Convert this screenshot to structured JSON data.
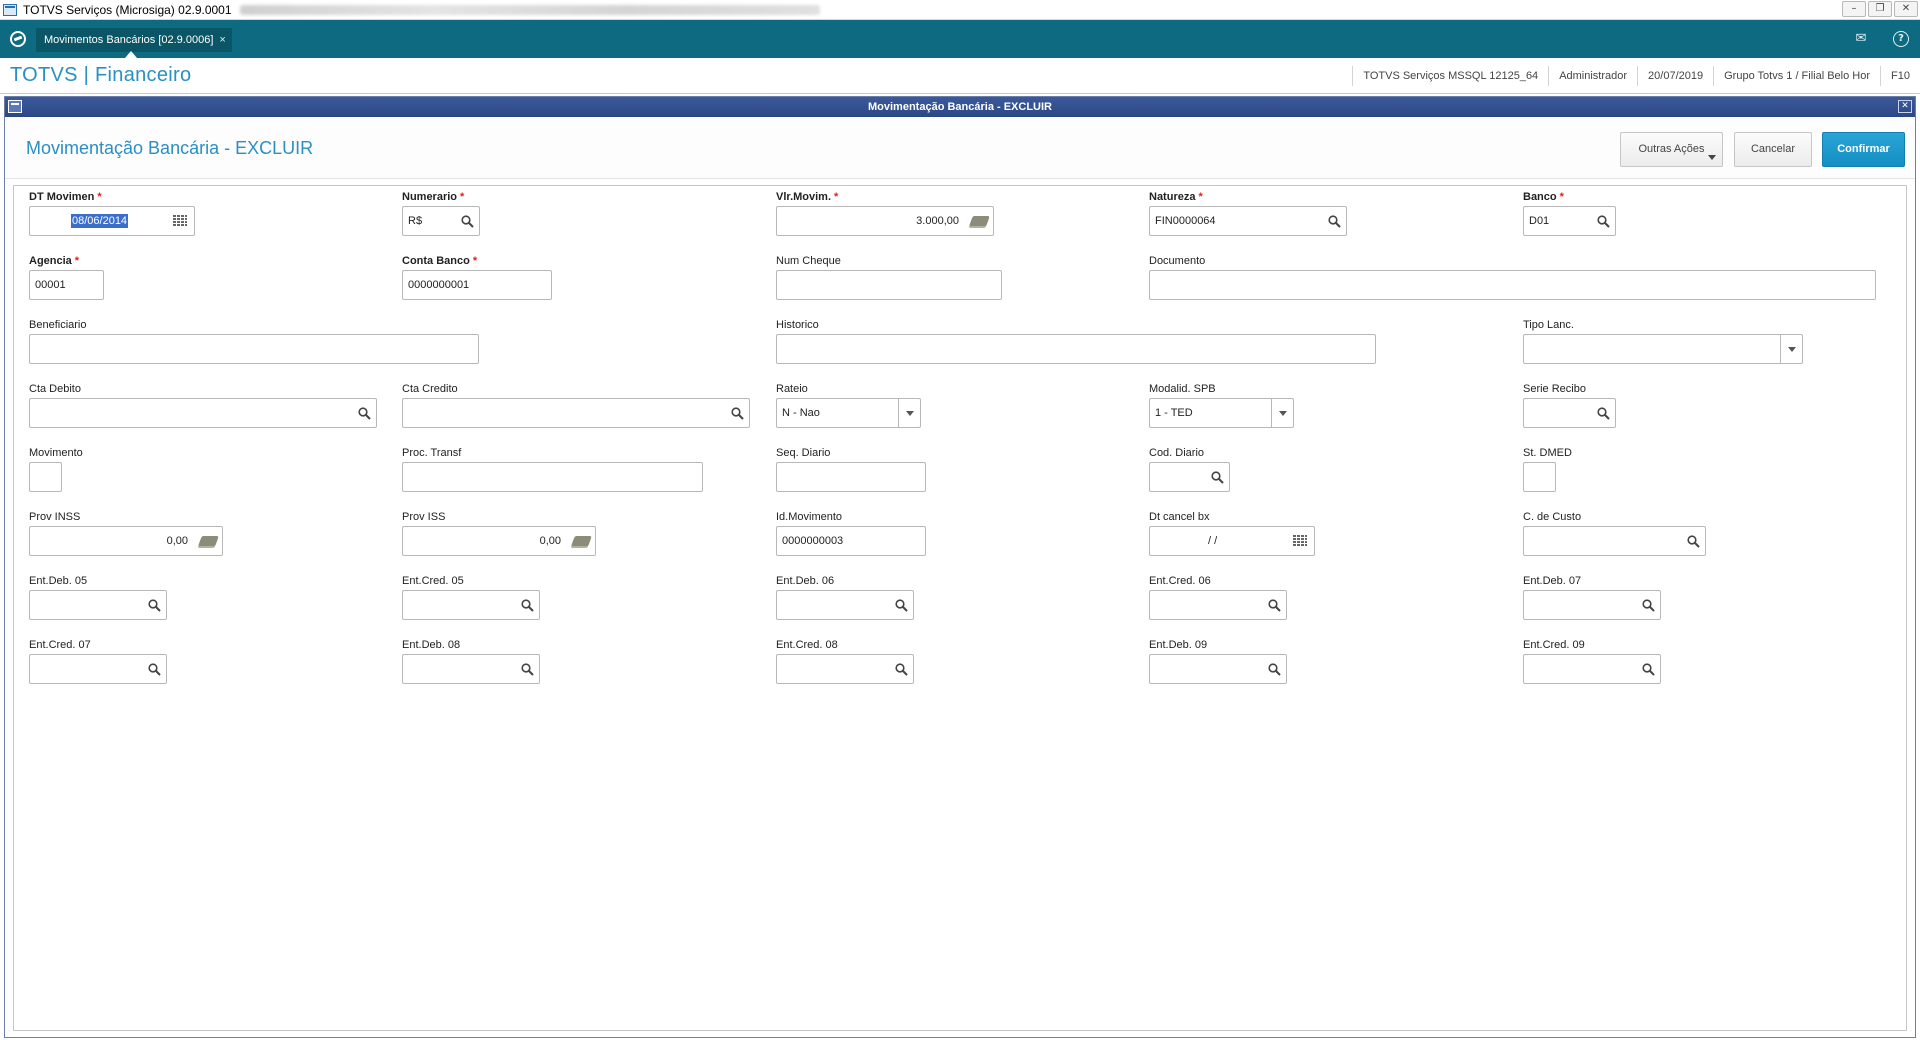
{
  "os": {
    "title": "TOTVS Serviços (Microsiga) 02.9.0001",
    "controls": {
      "minimize": "–",
      "restore": "❐",
      "close": "✕"
    }
  },
  "tabbar": {
    "active_tab": "Movimentos Bancários [02.9.0006]",
    "close_glyph": "×",
    "mail_icon": "✉",
    "help_icon": "?"
  },
  "module": {
    "title": "TOTVS | Financeiro",
    "info": [
      "TOTVS Serviços MSSQL 12125_64",
      "Administrador",
      "20/07/2019",
      "Grupo Totvs 1 / Filial Belo Hor",
      "F10"
    ]
  },
  "dialog": {
    "title": "Movimentação Bancária - EXCLUIR",
    "heading": "Movimentação Bancária - EXCLUIR",
    "close_glyph": "✕",
    "buttons": {
      "outras": "Outras Ações",
      "cancelar": "Cancelar",
      "confirmar": "Confirmar"
    }
  },
  "fields": {
    "dt_movimen": {
      "label": "DT Movimen",
      "value": "08/06/2014"
    },
    "numerario": {
      "label": "Numerario",
      "value": "R$"
    },
    "vlr_movim": {
      "label": "Vlr.Movim.",
      "value": "3.000,00"
    },
    "natureza": {
      "label": "Natureza",
      "value": "FIN0000064"
    },
    "banco": {
      "label": "Banco",
      "value": "D01"
    },
    "agencia": {
      "label": "Agencia",
      "value": "00001"
    },
    "conta_banco": {
      "label": "Conta Banco",
      "value": "0000000001"
    },
    "num_cheque": {
      "label": "Num Cheque",
      "value": ""
    },
    "documento": {
      "label": "Documento",
      "value": ""
    },
    "beneficiario": {
      "label": "Beneficiario",
      "value": ""
    },
    "historico": {
      "label": "Historico",
      "value": ""
    },
    "tipo_lanc": {
      "label": "Tipo Lanc.",
      "value": ""
    },
    "cta_debito": {
      "label": "Cta Debito",
      "value": ""
    },
    "cta_credito": {
      "label": "Cta Credito",
      "value": ""
    },
    "rateio": {
      "label": "Rateio",
      "value": "N - Nao"
    },
    "modalid_spb": {
      "label": "Modalid. SPB",
      "value": "1 - TED"
    },
    "serie_recibo": {
      "label": "Serie Recibo",
      "value": ""
    },
    "movimento": {
      "label": "Movimento",
      "value": ""
    },
    "proc_transf": {
      "label": "Proc. Transf",
      "value": ""
    },
    "seq_diario": {
      "label": "Seq. Diario",
      "value": ""
    },
    "cod_diario": {
      "label": "Cod. Diario",
      "value": ""
    },
    "st_dmed": {
      "label": "St. DMED",
      "value": ""
    },
    "prov_inss": {
      "label": "Prov INSS",
      "value": "0,00"
    },
    "prov_iss": {
      "label": "Prov ISS",
      "value": "0,00"
    },
    "id_movimento": {
      "label": "Id.Movimento",
      "value": "0000000003"
    },
    "dt_cancel_bx": {
      "label": "Dt cancel bx",
      "value": "/ /"
    },
    "c_custo": {
      "label": "C. de Custo",
      "value": ""
    },
    "ent_deb_05": {
      "label": "Ent.Deb. 05",
      "value": ""
    },
    "ent_cred_05": {
      "label": "Ent.Cred. 05",
      "value": ""
    },
    "ent_deb_06": {
      "label": "Ent.Deb. 06",
      "value": ""
    },
    "ent_cred_06": {
      "label": "Ent.Cred. 06",
      "value": ""
    },
    "ent_deb_07": {
      "label": "Ent.Deb. 07",
      "value": ""
    },
    "ent_cred_07": {
      "label": "Ent.Cred. 07",
      "value": ""
    },
    "ent_deb_08": {
      "label": "Ent.Deb. 08",
      "value": ""
    },
    "ent_cred_08": {
      "label": "Ent.Cred. 08",
      "value": ""
    },
    "ent_deb_09": {
      "label": "Ent.Deb. 09",
      "value": ""
    },
    "ent_cred_09": {
      "label": "Ent.Cred. 09",
      "value": ""
    }
  },
  "required_marker": "*",
  "colors": {
    "teal_bar": "#0d6a80",
    "accent_blue": "#2a8fc4",
    "confirm_blue": "#1c9bd0",
    "required_red": "#e02020"
  }
}
